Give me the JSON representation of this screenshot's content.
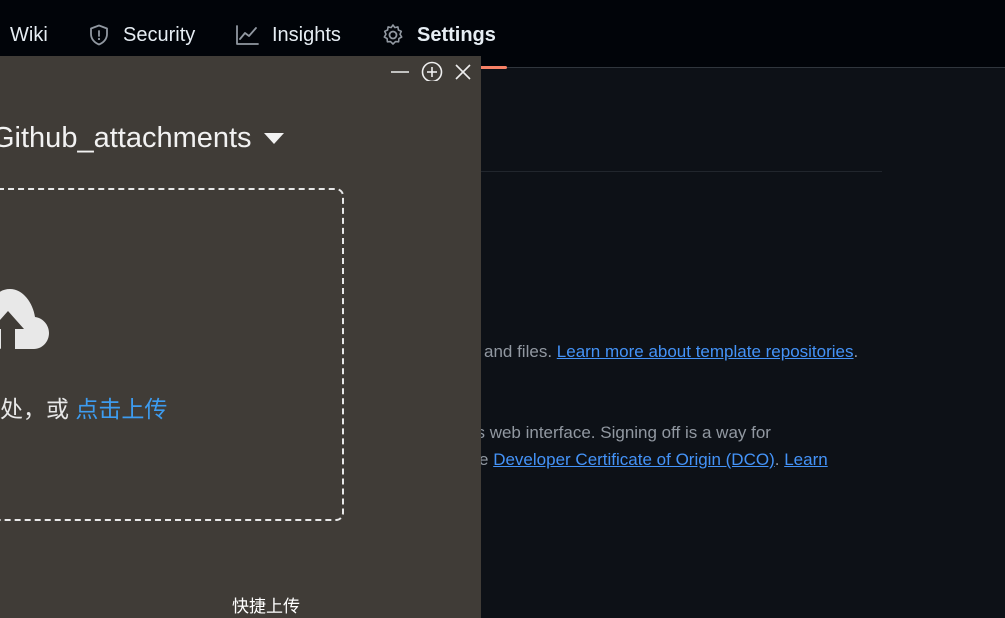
{
  "nav": {
    "items": [
      {
        "label": "Wiki",
        "icon": "book-icon"
      },
      {
        "label": "Security",
        "icon": "shield-icon"
      },
      {
        "label": "Insights",
        "icon": "graph-icon"
      },
      {
        "label": "Settings",
        "icon": "gear-icon"
      }
    ]
  },
  "settings": {
    "template_tail": "and files.",
    "template_link": "Learn more about template repositories",
    "template_period": ".",
    "signoff_line1": "’s web interface. Signing off is a way for",
    "signoff_prefix": "e",
    "dco_link": "Developer Certificate of Origin (DCO)",
    "dco_period": ".",
    "learn_link": "Learn"
  },
  "dialog": {
    "album_name": "Github_attachments",
    "drop_text": "处，或",
    "upload_link": "点击上传",
    "quick_upload": "快捷上传"
  },
  "colors": {
    "accent_link": "#4493f8",
    "dialog_bg": "#403c37",
    "nav_underline": "#f78166"
  }
}
